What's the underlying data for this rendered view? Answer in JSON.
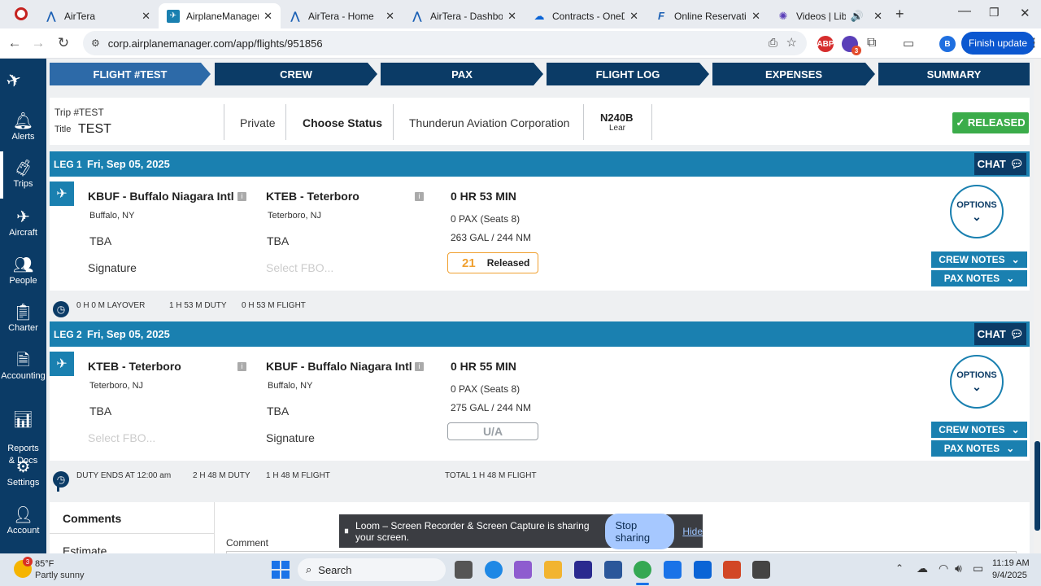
{
  "browser": {
    "tabs": [
      {
        "label": "AirTera",
        "active": false
      },
      {
        "label": "AirplaneManager",
        "active": true
      },
      {
        "label": "AirTera - Home",
        "active": false
      },
      {
        "label": "AirTera - Dashboard",
        "active": false
      },
      {
        "label": "Contracts - OneDrive",
        "active": false
      },
      {
        "label": "Online Reservation",
        "active": false
      },
      {
        "label": "Videos | Library",
        "active": false
      }
    ],
    "url": "corp.airplanemanager.com/app/flights/951856",
    "finish_update": "Finish update",
    "profile_initial": "B",
    "abp_label": "ABP",
    "ext_badge": "3"
  },
  "sidebar": {
    "items": [
      {
        "label": "Alerts",
        "icon": "bell-icon"
      },
      {
        "label": "Trips",
        "icon": "luggage-icon"
      },
      {
        "label": "Aircraft",
        "icon": "airplane-icon"
      },
      {
        "label": "People",
        "icon": "people-icon"
      },
      {
        "label": "Charter",
        "icon": "clipboard-icon"
      },
      {
        "label": "Accounting",
        "icon": "document-icon"
      },
      {
        "label": "Reports\n& Docs",
        "icon": "chart-doc-icon"
      },
      {
        "label": "Settings",
        "icon": "gear-icon"
      },
      {
        "label": "Account",
        "icon": "account-icon"
      }
    ]
  },
  "steps": [
    "FLIGHT #TEST",
    "CREW",
    "PAX",
    "FLIGHT LOG",
    "EXPENSES",
    "SUMMARY"
  ],
  "trip": {
    "trip_label": "Trip #",
    "trip_value": "TEST",
    "title_label": "Title",
    "title_value": "TEST",
    "type": "Private",
    "status": "Choose Status",
    "company": "Thunderun Aviation Corporation",
    "tail": "N240B",
    "aircraft": "Lear",
    "released_label": "✓ RELEASED"
  },
  "legs": [
    {
      "leg": "LEG 1",
      "date": "Fri, Sep 05, 2025",
      "chat": "CHAT",
      "from": "KBUF - Buffalo Niagara Intl",
      "from_city": "Buffalo, NY",
      "from_tba": "TBA",
      "from_fbo": "Signature",
      "to": "KTEB - Teterboro",
      "to_city": "Teterboro, NJ",
      "to_tba": "TBA",
      "to_fbo": "Select FBO...",
      "duration": "0 HR 53 MIN",
      "pax": "0 PAX (Seats 8)",
      "fuel": "263 GAL / 244 NM",
      "status_num": "21",
      "status_text": "Released",
      "options": "OPTIONS",
      "crew_notes": "CREW NOTES",
      "pax_notes": "PAX NOTES",
      "footer": [
        "0 H 0 M LAYOVER",
        "1 H 53 M DUTY",
        "0 H 53 M FLIGHT"
      ]
    },
    {
      "leg": "LEG 2",
      "date": "Fri, Sep 05, 2025",
      "chat": "CHAT",
      "from": "KTEB - Teterboro",
      "from_city": "Teterboro, NJ",
      "from_tba": "TBA",
      "from_fbo": "Select FBO...",
      "to": "KBUF - Buffalo Niagara Intl",
      "to_city": "Buffalo, NY",
      "to_tba": "TBA",
      "to_fbo": "Signature",
      "duration": "0 HR 55 MIN",
      "pax": "0 PAX (Seats 8)",
      "fuel": "275 GAL / 244 NM",
      "status_text": "U/A",
      "options": "OPTIONS",
      "crew_notes": "CREW NOTES",
      "pax_notes": "PAX NOTES",
      "footer": [
        "DUTY ENDS AT 12:00 am",
        "2 H 48 M DUTY",
        "1 H 48 M FLIGHT",
        "TOTAL 1 H 48 M FLIGHT"
      ]
    }
  ],
  "comments": {
    "title": "Comments",
    "estimate": "Estimate",
    "comment_label": "Comment"
  },
  "loom": {
    "message": "Loom – Screen Recorder & Screen Capture is sharing your screen.",
    "stop": "Stop sharing",
    "hide": "Hide"
  },
  "taskbar": {
    "weather_badge": "3",
    "temp": "85°F",
    "weather": "Partly sunny",
    "search": "Search",
    "time": "11:19 AM",
    "date": "9/4/2025"
  }
}
